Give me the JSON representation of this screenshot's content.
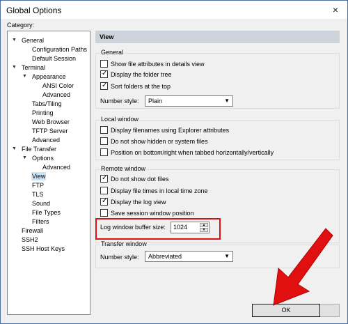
{
  "window": {
    "title": "Global Options",
    "close_glyph": "×"
  },
  "category_label": "Category:",
  "tree": [
    {
      "label": "General",
      "expanded": true
    },
    {
      "label": "Configuration Paths"
    },
    {
      "label": "Default Session"
    },
    {
      "label": "Terminal",
      "expanded": true
    },
    {
      "label": "Appearance",
      "expanded": true
    },
    {
      "label": "ANSI Color"
    },
    {
      "label": "Advanced"
    },
    {
      "label": "Tabs/Tiling"
    },
    {
      "label": "Printing"
    },
    {
      "label": "Web Browser"
    },
    {
      "label": "TFTP Server"
    },
    {
      "label": "Advanced"
    },
    {
      "label": "File Transfer",
      "expanded": true
    },
    {
      "label": "Options",
      "expanded": true
    },
    {
      "label": "Advanced"
    },
    {
      "label": "View",
      "selected": true
    },
    {
      "label": "FTP"
    },
    {
      "label": "TLS"
    },
    {
      "label": "Sound"
    },
    {
      "label": "File Types"
    },
    {
      "label": "Filters"
    },
    {
      "label": "Firewall"
    },
    {
      "label": "SSH2"
    },
    {
      "label": "SSH Host Keys"
    }
  ],
  "panel": {
    "header": "View",
    "general": {
      "title": "General",
      "items": [
        {
          "label": "Show file attributes in details view",
          "checked": false
        },
        {
          "label": "Display the folder tree",
          "checked": true
        },
        {
          "label": "Sort folders at the top",
          "checked": true
        }
      ],
      "number_style_label": "Number style:",
      "number_style_value": "Plain"
    },
    "local": {
      "title": "Local window",
      "items": [
        {
          "label": "Display filenames using Explorer attributes",
          "checked": false
        },
        {
          "label": "Do not show hidden or system files",
          "checked": false
        },
        {
          "label": "Position on bottom/right when tabbed horizontally/vertically",
          "checked": false
        }
      ]
    },
    "remote": {
      "title": "Remote window",
      "items": [
        {
          "label": "Do not show dot files",
          "checked": true
        },
        {
          "label": "Display file times in local time zone",
          "checked": false
        },
        {
          "label": "Display the log view",
          "checked": true
        },
        {
          "label": "Save session window position",
          "checked": false
        }
      ],
      "buffer_label": "Log window buffer size:",
      "buffer_value": "1024"
    },
    "transfer": {
      "title": "Transfer window",
      "number_style_label": "Number style:",
      "number_style_value": "Abbreviated"
    }
  },
  "buttons": {
    "ok": "OK"
  },
  "icons": {
    "expand": "chevron-down-icon",
    "dropdown": "chevron-down-icon",
    "spin_up": "triangle-up-icon",
    "spin_down": "triangle-down-icon",
    "close": "close-icon"
  },
  "colors": {
    "highlight_box": "#e01010",
    "arrow": "#e01010",
    "header_bg": "#cdd3da"
  }
}
